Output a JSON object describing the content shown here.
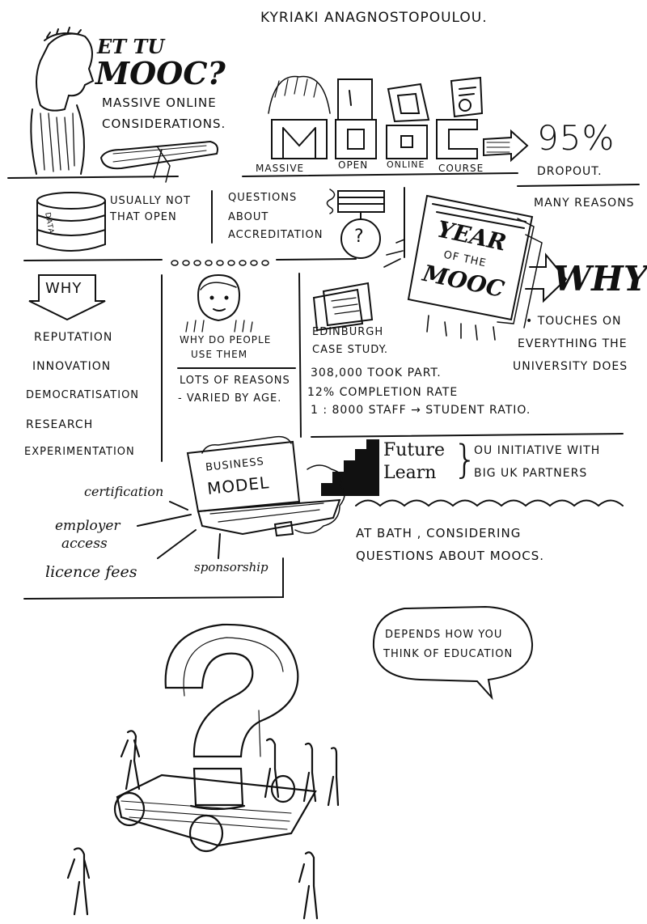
{
  "author": "KYRIAKI ANAGNOSTOPOULOU.",
  "title": {
    "line1": "ET TU",
    "line2": "MOOC?",
    "sub1": "MASSIVE ONLINE",
    "sub2": "CONSIDERATIONS."
  },
  "mooc_letters": [
    "MASSIVE",
    "OPEN",
    "ONLINE",
    "COURSE"
  ],
  "dropout": {
    "percent": "95%",
    "label": "DROPOUT.",
    "reasons": "MANY REASONS"
  },
  "data_box": {
    "icon_label": "DATA",
    "line1": "USUALLY NOT",
    "line2": "THAT OPEN"
  },
  "accreditation": {
    "line1": "QUESTIONS",
    "line2": "ABOUT",
    "line3": "ACCREDITATION"
  },
  "year": {
    "line1": "YEAR",
    "line2": "OF THE",
    "line3": "MOOC"
  },
  "why_big": "WHY",
  "touches": {
    "line1": "• TOUCHES ON",
    "line2": "EVERYTHING THE",
    "line3": "UNIVERSITY DOES"
  },
  "why_list": {
    "head": "WHY",
    "items": [
      "REPUTATION",
      "INNOVATION",
      "DEMOCRATISATION",
      "RESEARCH",
      "EXPERIMENTATION"
    ]
  },
  "people": {
    "line1": "WHY DO PEOPLE",
    "line2": "USE THEM",
    "line3": "LOTS OF REASONS",
    "line4": "- VARIED BY AGE."
  },
  "edinburgh": {
    "line1": "EDINBURGH",
    "line2": "CASE STUDY.",
    "stat1": "308,000 TOOK PART.",
    "stat2": "12% COMPLETION RATE",
    "stat3": "1 : 8000 STAFF → STUDENT RATIO."
  },
  "business": {
    "line1": "BUSINESS",
    "line2": "MODEL",
    "items": [
      "certification",
      "employer",
      "access",
      "licence fees",
      "sponsorship"
    ]
  },
  "futurelearn": {
    "line1": "Future",
    "line2": "Learn",
    "note1": "OU INITIATIVE WITH",
    "note2": "BIG UK PARTNERS"
  },
  "bath": {
    "line1": "AT BATH , CONSIDERING",
    "line2": "QUESTIONS ABOUT MOOCS."
  },
  "bubble": {
    "line1": "DEPENDS HOW YOU",
    "line2": "THINK OF EDUCATION"
  }
}
